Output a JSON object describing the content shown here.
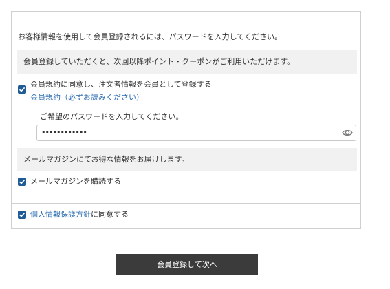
{
  "form": {
    "intro_text": "お客様情報を使用して会員登録されるには、パスワードを入力してください。",
    "member_info_text": "会員登録していただくと、次回以降ポイント・クーポンがご利用いただけます。",
    "terms_checkbox": {
      "label": "会員規約に同意し、注文者情報を会員として登録する",
      "checked": true
    },
    "terms_link": "会員規約（必ずお読みください）",
    "password": {
      "prompt": "ご希望のパスワードを入力してください。",
      "value": "••••••••••••"
    },
    "newsletter_info_text": "メールマガジンにてお得な情報をお届けします。",
    "newsletter_checkbox": {
      "label": "メールマガジンを購読する",
      "checked": true
    },
    "privacy": {
      "link_text": "個人情報保護方針",
      "suffix_text": "に同意する",
      "checked": true
    },
    "submit_label": "会員登録して次へ"
  },
  "colors": {
    "accent": "#1f5b94",
    "link": "#2b6cb0",
    "button": "#3b3b3b",
    "band": "#f1f1f1"
  },
  "icons": {
    "password_toggle": "eye-icon",
    "checkbox": "checkmark-icon"
  }
}
